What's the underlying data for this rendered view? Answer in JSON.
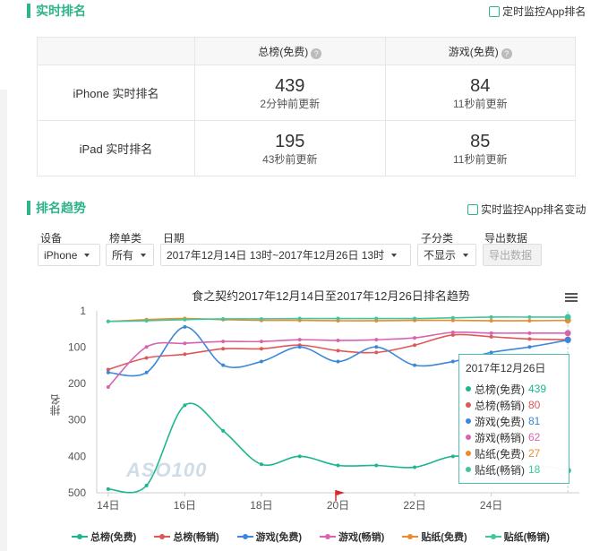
{
  "realtime": {
    "title": "实时排名",
    "monitor_label": "定时监控App排名",
    "col_total": "总榜(免费)",
    "col_game": "游戏(免费)",
    "help_icon": "question-icon",
    "rows": [
      {
        "label": "iPhone 实时排名",
        "total_rank": "439",
        "total_update": "2分钟前更新",
        "game_rank": "84",
        "game_update": "11秒前更新"
      },
      {
        "label": "iPad 实时排名",
        "total_rank": "195",
        "total_update": "43秒前更新",
        "game_rank": "85",
        "game_update": "11秒前更新"
      }
    ]
  },
  "trend": {
    "title": "排名趋势",
    "monitor_label": "实时监控App排名变动",
    "filters": {
      "device_label": "设备",
      "device_value": "iPhone",
      "list_label": "榜单类",
      "list_value": "所有",
      "date_label": "日期",
      "date_value": "2017年12月14日 13时~2017年12月26日 13时",
      "subcat_label": "子分类",
      "subcat_value": "不显示",
      "export_label": "导出数据",
      "export_button": "导出数据"
    },
    "menu_icon": "hamburger-menu-icon",
    "watermark": "ASO100",
    "flag_icon": "red-flag-icon"
  },
  "chart_data": {
    "type": "line",
    "title": "食之契约2017年12月14日至2017年12月26日排名趋势",
    "ylabel": "排名",
    "y_reversed": true,
    "ylim": [
      1,
      500
    ],
    "y_ticks": [
      "1",
      "100",
      "200",
      "300",
      "400",
      "500"
    ],
    "x_ticks": [
      "14日",
      "16日",
      "18日",
      "20日",
      "22日",
      "24日"
    ],
    "x": [
      14,
      15,
      16,
      17,
      18,
      19,
      20,
      21,
      22,
      23,
      24,
      25,
      26
    ],
    "series": [
      {
        "name": "总榜(免费)",
        "color": "#1db68f",
        "values": [
          490,
          480,
          260,
          330,
          422,
          400,
          425,
          425,
          430,
          400,
          410,
          420,
          439
        ]
      },
      {
        "name": "总榜(畅销)",
        "color": "#e05757",
        "values": [
          162,
          130,
          120,
          105,
          105,
          95,
          110,
          115,
          95,
          67,
          72,
          78,
          80
        ]
      },
      {
        "name": "游戏(免费)",
        "color": "#3d87d8",
        "values": [
          170,
          170,
          45,
          150,
          140,
          100,
          140,
          100,
          150,
          140,
          115,
          100,
          81
        ]
      },
      {
        "name": "游戏(畅销)",
        "color": "#d864b0",
        "values": [
          210,
          100,
          90,
          85,
          85,
          80,
          82,
          80,
          75,
          60,
          62,
          62,
          62
        ]
      },
      {
        "name": "贴纸(免费)",
        "color": "#ee8a2d",
        "values": [
          30,
          25,
          22,
          25,
          27,
          27,
          28,
          28,
          27,
          27,
          28,
          28,
          27
        ]
      },
      {
        "name": "贴纸(畅销)",
        "color": "#3fc69d",
        "values": [
          30,
          28,
          25,
          23,
          23,
          22,
          22,
          22,
          22,
          20,
          18,
          18,
          18
        ]
      }
    ],
    "tooltip": {
      "title": "2017年12月26日",
      "rows": [
        {
          "name": "总榜(免费)",
          "value": "439",
          "color": "#1db68f"
        },
        {
          "name": "总榜(畅销)",
          "value": "80",
          "color": "#e05757"
        },
        {
          "name": "游戏(免费)",
          "value": "81",
          "color": "#3d87d8"
        },
        {
          "name": "游戏(畅销)",
          "value": "62",
          "color": "#d864b0"
        },
        {
          "name": "贴纸(免费)",
          "value": "27",
          "color": "#ee8a2d"
        },
        {
          "name": "贴纸(畅销)",
          "value": "18",
          "color": "#3fc69d"
        }
      ]
    }
  }
}
